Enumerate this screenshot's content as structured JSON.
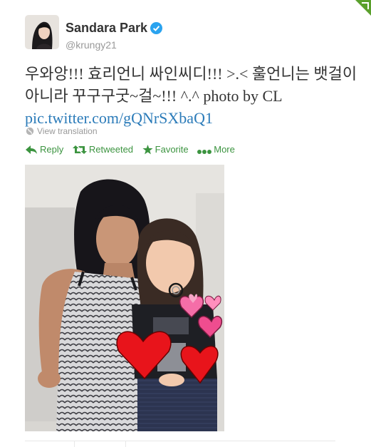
{
  "tweet": {
    "author": {
      "name": "Sandara Park",
      "username": "@krungy21",
      "verified": true
    },
    "text_main": "우와앙!!! 효리언니 싸인씨디!!! >.< 훌언니는 뱃걸이 아니라 꾸구구굿~걸~!!! ^.^ photo by CL ",
    "link": "pic.twitter.com/gQNrSXbaQ1",
    "translate_label": "View translation",
    "actions": {
      "reply": "Reply",
      "retweeted": "Retweeted",
      "favorite": "Favorite",
      "more": "More"
    }
  },
  "colors": {
    "action_green": "#3c9440",
    "link_blue": "#2b7bb9",
    "verified_blue": "#2aa3ef",
    "muted": "#999999"
  },
  "icons": [
    "globe-icon",
    "reply-icon",
    "retweet-icon",
    "favorite-star-icon",
    "more-dots-icon",
    "verified-badge-icon"
  ]
}
